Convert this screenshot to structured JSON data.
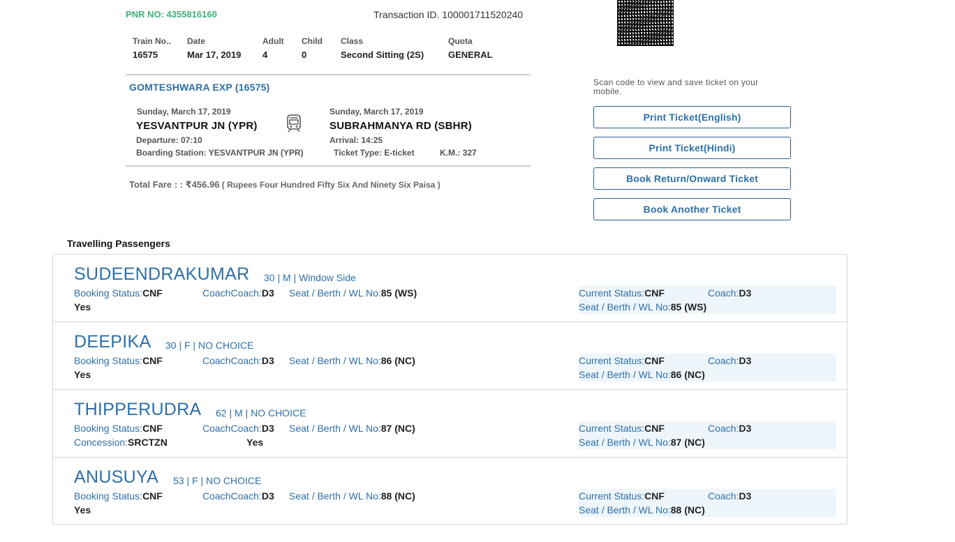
{
  "header": {
    "pnr": "PNR NO: 4355816160",
    "transaction": "Transaction ID. 100001711520240"
  },
  "info": [
    {
      "label": "Train No..",
      "value": "16575"
    },
    {
      "label": "Date",
      "value": "Mar 17, 2019"
    },
    {
      "label": "Adult",
      "value": "4"
    },
    {
      "label": "Child",
      "value": "0"
    },
    {
      "label": "Class",
      "value": "Second Sitting (2S)"
    },
    {
      "label": "Quota",
      "value": "GENERAL"
    }
  ],
  "train": {
    "name": "GOMTESHWARA EXP (16575)",
    "from_date": "Sunday, March 17, 2019",
    "from_station": "YESVANTPUR JN (YPR)",
    "to_date": "Sunday, March 17, 2019",
    "to_station": "SUBRAHMANYA RD (SBHR)",
    "departure": "Departure: 07:10",
    "arrival": "Arrival: 14:25",
    "boarding": "Boarding Station: YESVANTPUR JN (YPR)",
    "ticket_type": "Ticket Type: E-ticket",
    "km": "K.M.: 327",
    "train_icon": "train-icon"
  },
  "fare": {
    "label": "Total Fare : : ",
    "amount": "₹456.96",
    "words": " ( Rupees Four Hundred Fifty Six And Ninety Six Paisa )"
  },
  "right": {
    "scan_text": "Scan code to view and save ticket on your mobile.",
    "buttons": [
      "Print Ticket(English)",
      "Print Ticket(Hindi)",
      "Book Return/Onward Ticket",
      "Book Another Ticket"
    ]
  },
  "passengers_title": "Travelling Passengers",
  "labels": {
    "booking_status": "Booking Status:",
    "coach": "CoachCoach:",
    "seat": "Seat / Berth / WL No:",
    "current_status": "Current Status:",
    "current_coach": "Coach:",
    "concession": "Concession:"
  },
  "passengers": [
    {
      "name": "SUDEENDRAKUMAR",
      "meta": "30 | M | Window Side",
      "booking_status": "CNF",
      "coach": "D3",
      "seat": "85 (WS)",
      "current_status": "CNF",
      "current_coach": "D3",
      "current_seat": "85 (WS)",
      "yes": "Yes",
      "concession": ""
    },
    {
      "name": "DEEPIKA",
      "meta": "30 | F | NO CHOICE",
      "booking_status": "CNF",
      "coach": "D3",
      "seat": "86 (NC)",
      "current_status": "CNF",
      "current_coach": "D3",
      "current_seat": "86 (NC)",
      "yes": "Yes",
      "concession": ""
    },
    {
      "name": "THIPPERUDRA",
      "meta": "62 | M | NO CHOICE",
      "booking_status": "CNF",
      "coach": "D3",
      "seat": "87 (NC)",
      "current_status": "CNF",
      "current_coach": "D3",
      "current_seat": "87 (NC)",
      "yes": "Yes",
      "concession": "SRCTZN"
    },
    {
      "name": "ANUSUYA",
      "meta": "53 | F | NO CHOICE",
      "booking_status": "CNF",
      "coach": "D3",
      "seat": "88 (NC)",
      "current_status": "CNF",
      "current_coach": "D3",
      "current_seat": "88 (NC)",
      "yes": "Yes",
      "concession": ""
    }
  ]
}
